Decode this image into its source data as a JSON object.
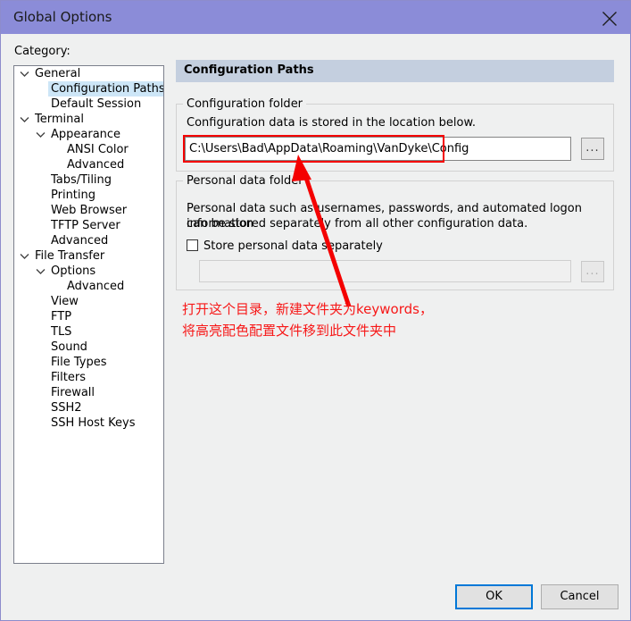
{
  "window": {
    "title": "Global Options",
    "close_icon": "close-icon",
    "accent_title_bg": "#8b8cd8",
    "panel_header_bg": "#c4cfdf",
    "annotation_color": "#f40000"
  },
  "sidebar": {
    "label": "Category:",
    "items": [
      {
        "label": "General",
        "depth": 0,
        "chevron": true,
        "selected": false
      },
      {
        "label": "Configuration Paths",
        "depth": 1,
        "chevron": false,
        "selected": true
      },
      {
        "label": "Default Session",
        "depth": 1,
        "chevron": false,
        "selected": false
      },
      {
        "label": "Terminal",
        "depth": 0,
        "chevron": true,
        "selected": false
      },
      {
        "label": "Appearance",
        "depth": 1,
        "chevron": true,
        "selected": false
      },
      {
        "label": "ANSI Color",
        "depth": 2,
        "chevron": false,
        "selected": false
      },
      {
        "label": "Advanced",
        "depth": 2,
        "chevron": false,
        "selected": false
      },
      {
        "label": "Tabs/Tiling",
        "depth": 1,
        "chevron": false,
        "selected": false
      },
      {
        "label": "Printing",
        "depth": 1,
        "chevron": false,
        "selected": false
      },
      {
        "label": "Web Browser",
        "depth": 1,
        "chevron": false,
        "selected": false
      },
      {
        "label": "TFTP Server",
        "depth": 1,
        "chevron": false,
        "selected": false
      },
      {
        "label": "Advanced",
        "depth": 1,
        "chevron": false,
        "selected": false
      },
      {
        "label": "File Transfer",
        "depth": 0,
        "chevron": true,
        "selected": false
      },
      {
        "label": "Options",
        "depth": 1,
        "chevron": true,
        "selected": false
      },
      {
        "label": "Advanced",
        "depth": 2,
        "chevron": false,
        "selected": false
      },
      {
        "label": "View",
        "depth": 1,
        "chevron": false,
        "selected": false
      },
      {
        "label": "FTP",
        "depth": 1,
        "chevron": false,
        "selected": false
      },
      {
        "label": "TLS",
        "depth": 1,
        "chevron": false,
        "selected": false
      },
      {
        "label": "Sound",
        "depth": 1,
        "chevron": false,
        "selected": false
      },
      {
        "label": "File Types",
        "depth": 1,
        "chevron": false,
        "selected": false
      },
      {
        "label": "Filters",
        "depth": 1,
        "chevron": false,
        "selected": false
      },
      {
        "label": "Firewall",
        "depth": 1,
        "chevron": false,
        "selected": false
      },
      {
        "label": "SSH2",
        "depth": 1,
        "chevron": false,
        "selected": false
      },
      {
        "label": "SSH Host Keys",
        "depth": 1,
        "chevron": false,
        "selected": false
      }
    ]
  },
  "main": {
    "header": "Configuration Paths",
    "config_group": {
      "legend": "Configuration folder",
      "description": "Configuration data is stored in the location below.",
      "path_value": "C:\\Users\\Bad\\AppData\\Roaming\\VanDyke\\Config",
      "browse_label": "..."
    },
    "personal_group": {
      "legend": "Personal data folder",
      "description_line1": "Personal data such as usernames, passwords, and automated logon information",
      "description_line2": "can be stored separately from all other configuration data.",
      "checkbox_label": "Store personal data separately",
      "checkbox_checked": false,
      "path_value": "",
      "path_placeholder": "",
      "browse_label": "..."
    }
  },
  "annotation": {
    "line1": "打开这个目录，新建文件夹为keywords，",
    "line2": "将高亮配色配置文件移到此文件夹中"
  },
  "footer": {
    "ok_label": "OK",
    "cancel_label": "Cancel"
  }
}
